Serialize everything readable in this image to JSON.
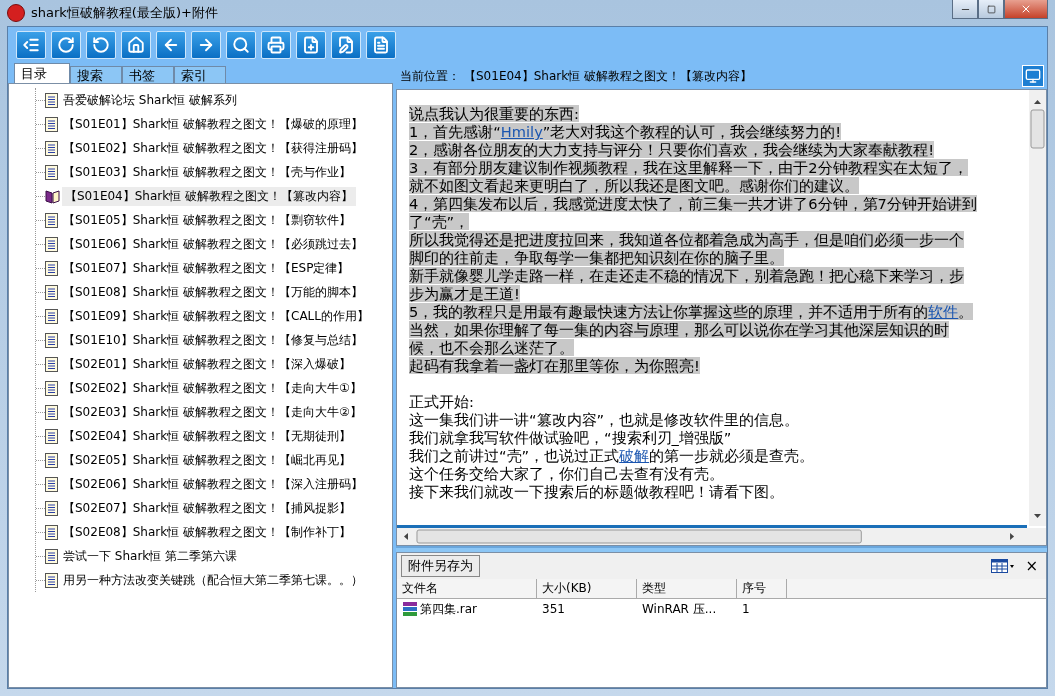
{
  "window": {
    "title": "shark恒破解教程(最全版)+附件"
  },
  "tabs": [
    {
      "label": "目录",
      "selected": true
    },
    {
      "label": "搜索",
      "selected": false
    },
    {
      "label": "书签",
      "selected": false
    },
    {
      "label": "索引",
      "selected": false
    }
  ],
  "tree": {
    "items": [
      {
        "label": "吾爱破解论坛 Shark恒 破解系列",
        "selected": false
      },
      {
        "label": "【S01E01】Shark恒 破解教程之图文！【爆破的原理】",
        "selected": false
      },
      {
        "label": "【S01E02】Shark恒 破解教程之图文！【获得注册码】",
        "selected": false
      },
      {
        "label": "【S01E03】Shark恒 破解教程之图文！【壳与作业】",
        "selected": false
      },
      {
        "label": "【S01E04】Shark恒 破解教程之图文！【篡改内容】",
        "selected": true
      },
      {
        "label": "【S01E05】Shark恒 破解教程之图文！【剽窃软件】",
        "selected": false
      },
      {
        "label": "【S01E06】Shark恒 破解教程之图文！【必须跳过去】",
        "selected": false
      },
      {
        "label": "【S01E07】Shark恒 破解教程之图文！【ESP定律】",
        "selected": false
      },
      {
        "label": "【S01E08】Shark恒 破解教程之图文！【万能的脚本】",
        "selected": false
      },
      {
        "label": "【S01E09】Shark恒 破解教程之图文！【CALL的作用】",
        "selected": false
      },
      {
        "label": "【S01E10】Shark恒 破解教程之图文！【修复与总结】",
        "selected": false
      },
      {
        "label": "【S02E01】Shark恒 破解教程之图文！【深入爆破】",
        "selected": false
      },
      {
        "label": "【S02E02】Shark恒 破解教程之图文！【走向大牛①】",
        "selected": false
      },
      {
        "label": "【S02E03】Shark恒 破解教程之图文！【走向大牛②】",
        "selected": false
      },
      {
        "label": "【S02E04】Shark恒 破解教程之图文！【无期徒刑】",
        "selected": false
      },
      {
        "label": "【S02E05】Shark恒 破解教程之图文！【崛北再见】",
        "selected": false
      },
      {
        "label": "【S02E06】Shark恒 破解教程之图文！【深入注册码】",
        "selected": false
      },
      {
        "label": "【S02E07】Shark恒 破解教程之图文！【捕风捉影】",
        "selected": false
      },
      {
        "label": "【S02E08】Shark恒 破解教程之图文！【制作补丁】",
        "selected": false
      },
      {
        "label": "尝试一下 Shark恒 第二季第六课",
        "selected": false
      },
      {
        "label": "用另一种方法改变关键跳（配合恒大第二季第七课。。）",
        "selected": false
      }
    ]
  },
  "location": {
    "label": "当前位置：",
    "value": "【S01E04】Shark恒 破解教程之图文！【篡改内容】"
  },
  "content": {
    "lines": [
      {
        "highlighted": true,
        "parts": [
          {
            "text": "说点我认为很重要的东西:"
          }
        ]
      },
      {
        "highlighted": true,
        "parts": [
          {
            "text": "1，首先感谢“"
          },
          {
            "text": "Hmily",
            "kind": "link"
          },
          {
            "text": "”老大对我这个教程的认可，我会继续努力的!"
          }
        ]
      },
      {
        "highlighted": true,
        "parts": [
          {
            "text": "2，感谢各位朋友的大力支持与评分！只要你们喜欢，我会继续为大家奉献教程!"
          }
        ]
      },
      {
        "highlighted": true,
        "parts": [
          {
            "text": "3，有部分朋友建议制作视频教程，我在这里解释一下，由于2分钟教程实在太短了，"
          }
        ]
      },
      {
        "highlighted": true,
        "parts": [
          {
            "text": "就不如图文看起来更明白了，所以我还是图文吧。感谢你们的建议。"
          }
        ]
      },
      {
        "highlighted": true,
        "parts": [
          {
            "text": "4，第四集发布以后，我感觉进度太快了，前三集一共才讲了6分钟，第7分钟开始讲到"
          }
        ]
      },
      {
        "highlighted": true,
        "parts": [
          {
            "text": "了“壳”，"
          }
        ]
      },
      {
        "highlighted": true,
        "parts": [
          {
            "text": "所以我觉得还是把进度拉回来，我知道各位都着急成为高手，但是咱们必须一步一个"
          }
        ]
      },
      {
        "highlighted": true,
        "parts": [
          {
            "text": "脚印的往前走，争取每学一集都把知识刻在你的脑子里。"
          }
        ]
      },
      {
        "highlighted": true,
        "parts": [
          {
            "text": "新手就像婴儿学走路一样，在走还走不稳的情况下，别着急跑！把心稳下来学习，步"
          }
        ]
      },
      {
        "highlighted": true,
        "parts": [
          {
            "text": "步为赢才是王道!"
          }
        ]
      },
      {
        "highlighted": true,
        "parts": [
          {
            "text": "5，我的教程只是用最有趣最快速方法让你掌握这些的原理，并不适用于所有的"
          },
          {
            "text": "软件",
            "kind": "link"
          },
          {
            "text": "。"
          }
        ]
      },
      {
        "highlighted": true,
        "parts": [
          {
            "text": "当然，如果你理解了每一集的内容与原理，那么可以说你在学习其他深层知识的时"
          }
        ]
      },
      {
        "highlighted": true,
        "parts": [
          {
            "text": "候，也不会那么迷茫了。"
          }
        ]
      },
      {
        "highlighted": true,
        "parts": [
          {
            "text": "起码有我拿着一盏灯在那里等你，为你照亮!"
          }
        ]
      },
      {
        "highlighted": false,
        "spaced": true,
        "parts": [
          {
            "text": "正式开始:"
          }
        ]
      },
      {
        "highlighted": false,
        "parts": [
          {
            "text": "这一集我们讲一讲“篡改内容”，也就是修改软件里的信息。"
          }
        ]
      },
      {
        "highlighted": false,
        "parts": [
          {
            "text": "我们就拿我写软件做试验吧，“搜索利刃_增强版”"
          }
        ]
      },
      {
        "highlighted": false,
        "parts": [
          {
            "text": "我们之前讲过“壳”，也说过正式"
          },
          {
            "text": "破解",
            "kind": "link"
          },
          {
            "text": "的第一步就必须是查壳。"
          }
        ]
      },
      {
        "highlighted": false,
        "parts": [
          {
            "text": "这个任务交给大家了，你们自己去查有没有壳。"
          }
        ]
      },
      {
        "highlighted": false,
        "parts": [
          {
            "text": "接下来我们就改一下搜索后的标题做教程吧！请看下图。"
          }
        ]
      }
    ]
  },
  "attachments": {
    "save_button": "附件另存为",
    "close": "×",
    "columns": [
      "文件名",
      "大小(KB)",
      "类型",
      "序号"
    ],
    "rows": [
      [
        "第四集.rar",
        "351",
        "WinRAR 压...",
        "1"
      ]
    ]
  }
}
